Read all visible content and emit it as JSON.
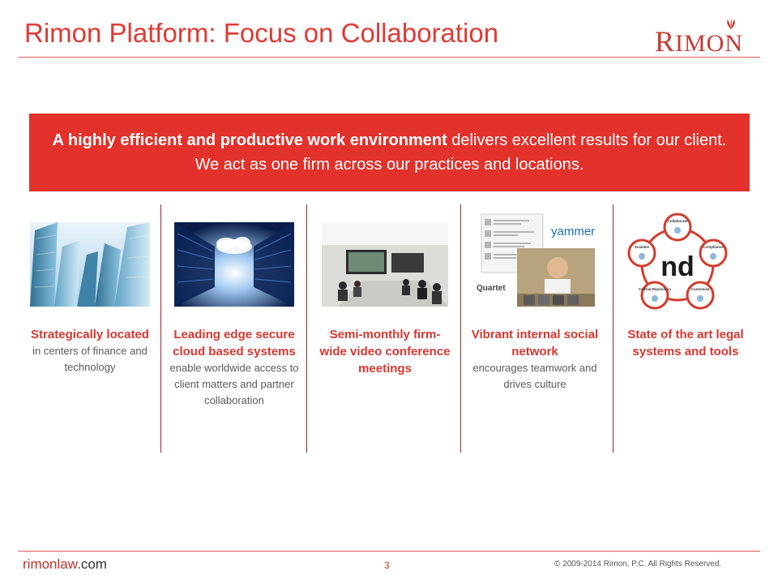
{
  "slide": {
    "title": "Rimon Platform: Focus on Collaboration",
    "logo_text_r": "R",
    "logo_text_rest": "IMON",
    "banner_bold": "A highly efficient and productive work environment",
    "banner_rest": " delivers excellent results for our client. We act as one firm across our practices and locations."
  },
  "columns": [
    {
      "head": "Strategically located",
      "desc": "in centers of finance and technology"
    },
    {
      "head": "Leading edge secure cloud based systems",
      "desc": "enable worldwide access to client matters and partner collaboration"
    },
    {
      "head": "Semi-monthly firm-wide video conference meetings",
      "desc": ""
    },
    {
      "head": "Vibrant internal social network",
      "desc": "encourages teamwork and drives culture"
    },
    {
      "head": "State of the art legal systems and tools",
      "desc": ""
    }
  ],
  "images": {
    "yammer_label": "yammer",
    "quartet_label": "Quartet",
    "nd_label": "nd",
    "nd_nodes": [
      "Collaborate",
      "Compliance",
      "Customize",
      "Central Repository",
      "Scalable"
    ]
  },
  "footer": {
    "site_main": "rimonlaw",
    "site_tld": ".com",
    "page": "3",
    "copyright": "© 2009-2014 Rimon, P.C. All Rights Reserved."
  },
  "colors": {
    "accent": "#e3312b",
    "text_gray": "#5a5a5a"
  }
}
